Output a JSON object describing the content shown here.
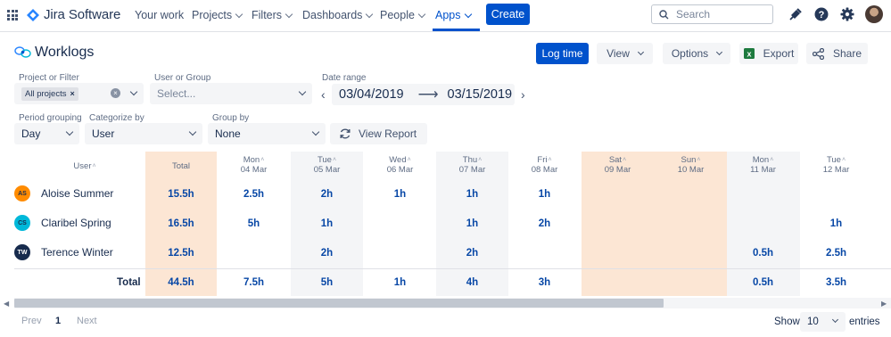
{
  "nav": {
    "app_name": "Jira Software",
    "items": [
      {
        "label": "Your work",
        "dropdown": false
      },
      {
        "label": "Projects",
        "dropdown": true
      },
      {
        "label": "Filters",
        "dropdown": true
      },
      {
        "label": "Dashboards",
        "dropdown": true
      },
      {
        "label": "People",
        "dropdown": true
      },
      {
        "label": "Apps",
        "dropdown": true,
        "active": true
      }
    ],
    "create_label": "Create",
    "search_placeholder": "Search",
    "icons": [
      "notifications-icon",
      "help-icon",
      "settings-icon",
      "profile-avatar"
    ]
  },
  "header": {
    "title": "Worklogs",
    "log_time": "Log time",
    "view": "View",
    "options": "Options",
    "export": "Export",
    "share": "Share"
  },
  "filters": {
    "project_label": "Project or Filter",
    "project_tag": "All projects",
    "user_label": "User or Group",
    "user_placeholder": "Select...",
    "date_label": "Date range",
    "date_from": "03/04/2019",
    "date_to": "03/15/2019",
    "period_label": "Period grouping",
    "period_value": "Day",
    "categorize_label": "Categorize by",
    "categorize_value": "User",
    "group_label": "Group by",
    "group_value": "None",
    "view_report": "View Report"
  },
  "table": {
    "user_header": "User",
    "total_header": "Total",
    "columns": [
      {
        "day": "Mon",
        "date": "04 Mar"
      },
      {
        "day": "Tue",
        "date": "05 Mar"
      },
      {
        "day": "Wed",
        "date": "06 Mar"
      },
      {
        "day": "Thu",
        "date": "07 Mar"
      },
      {
        "day": "Fri",
        "date": "08 Mar"
      },
      {
        "day": "Sat",
        "date": "09 Mar"
      },
      {
        "day": "Sun",
        "date": "10 Mar"
      },
      {
        "day": "Mon",
        "date": "11 Mar"
      },
      {
        "day": "Tue",
        "date": "12 Mar"
      }
    ],
    "rows": [
      {
        "initials": "AS",
        "name": "Aloise Summer",
        "avatar_color": "#ff8b00",
        "total": "15.5h",
        "cells": [
          "2.5h",
          "2h",
          "1h",
          "1h",
          "1h",
          "",
          "",
          "",
          ""
        ]
      },
      {
        "initials": "CS",
        "name": "Claribel Spring",
        "avatar_color": "#00b8d9",
        "total": "16.5h",
        "cells": [
          "5h",
          "1h",
          "",
          "1h",
          "2h",
          "",
          "",
          "",
          "1h"
        ]
      },
      {
        "initials": "TW",
        "name": "Terence Winter",
        "avatar_color": "#172b4d",
        "total": "12.5h",
        "cells": [
          "",
          "2h",
          "",
          "2h",
          "",
          "",
          "",
          "0.5h",
          "2.5h"
        ]
      }
    ],
    "total_row": {
      "label": "Total",
      "total": "44.5h",
      "cells": [
        "7.5h",
        "5h",
        "1h",
        "4h",
        "3h",
        "",
        "",
        "0.5h",
        "3.5h"
      ]
    }
  },
  "pagination": {
    "prev": "Prev",
    "page": "1",
    "next": "Next",
    "show": "Show",
    "page_size": "10",
    "entries": "entries"
  },
  "colors": {
    "accent": "#0052cc",
    "weekend_shade": "#fce6d4",
    "value_text": "#0747a6"
  }
}
